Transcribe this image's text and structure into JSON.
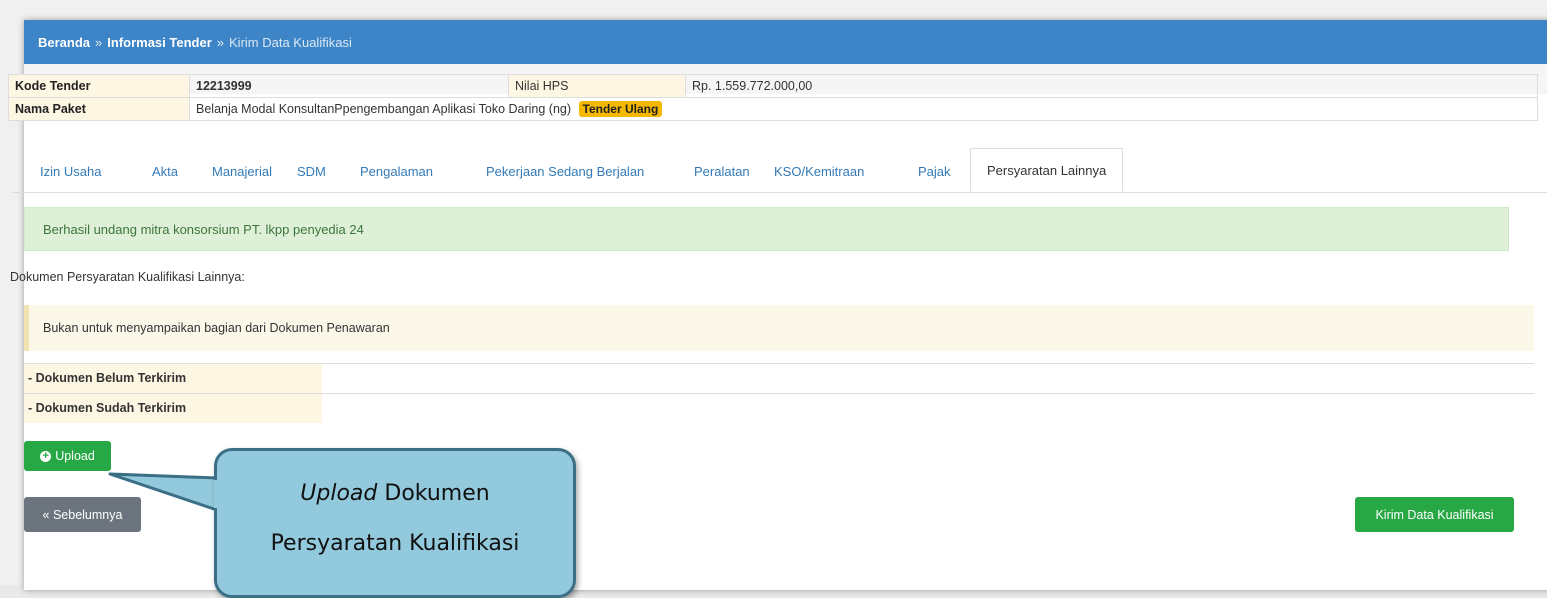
{
  "breadcrumb": {
    "home": "Beranda",
    "sep": "»",
    "tender": "Informasi Tender",
    "current": "Kirim Data Kualifikasi"
  },
  "info": {
    "kode_label": "Kode Tender",
    "kode_value": "12213999",
    "hps_label": "Nilai HPS",
    "hps_value": "Rp. 1.559.772.000,00",
    "paket_label": "Nama Paket",
    "paket_value": "Belanja Modal KonsultanPpengembangan Aplikasi Toko Daring (ng)",
    "badge": "Tender Ulang"
  },
  "tabs": [
    {
      "label": "Izin Usaha"
    },
    {
      "label": "Akta"
    },
    {
      "label": "Manajerial"
    },
    {
      "label": "SDM"
    },
    {
      "label": "Pengalaman"
    },
    {
      "label": "Pekerjaan Sedang Berjalan"
    },
    {
      "label": "Peralatan"
    },
    {
      "label": "KSO/Kemitraan"
    },
    {
      "label": "Pajak"
    },
    {
      "label": "Persyaratan Lainnya"
    }
  ],
  "alert": "Berhasil undang mitra konsorsium PT. lkpp penyedia 24",
  "doc_section_label": "Dokumen Persyaratan Kualifikasi Lainnya:",
  "note": "Bukan untuk menyampaikan bagian dari Dokumen Penawaran",
  "doc_rows": [
    {
      "label": "- Dokumen Belum Terkirim"
    },
    {
      "label": "- Dokumen Sudah Terkirim"
    }
  ],
  "buttons": {
    "upload": "Upload",
    "prev": "« Sebelumnya",
    "send": "Kirim Data Kualifikasi"
  },
  "callout": {
    "line1_em": "Upload",
    "line1_rest": " Dokumen",
    "line2": "Persyaratan Kualifikasi"
  },
  "colors": {
    "header": "#3d85c6",
    "success": "#28a745",
    "callout_fill": "#93c9dc",
    "callout_border": "#3a6f85"
  }
}
